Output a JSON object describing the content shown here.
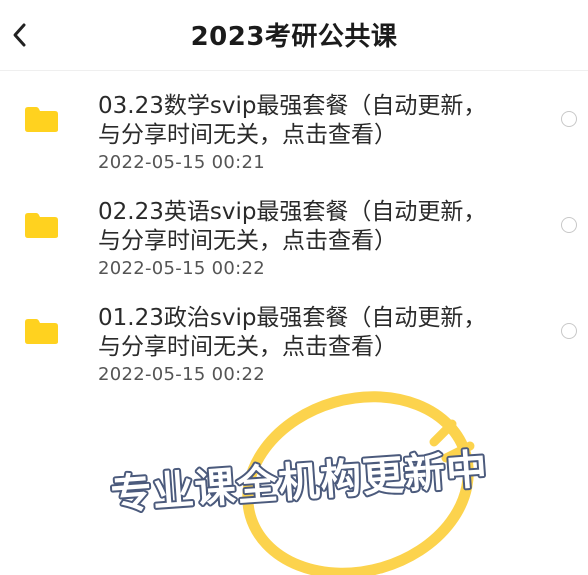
{
  "header": {
    "title": "2023考研公共课"
  },
  "files": [
    {
      "name": "03.23数学svip最强套餐（自动更新，与分享时间无关，点击查看）",
      "date": "2022-05-15 00:21"
    },
    {
      "name": "02.23英语svip最强套餐（自动更新，与分享时间无关，点击查看）",
      "date": "2022-05-15 00:22"
    },
    {
      "name": "01.23政治svip最强套餐（自动更新，与分享时间无关，点击查看）",
      "date": "2022-05-15 00:22"
    }
  ],
  "overlay": {
    "text": "专业课全机构更新中"
  },
  "colors": {
    "folder": "#FFD21F",
    "accent_yellow": "#FCD34D",
    "overlay_blue": "#4B5A7C"
  },
  "icons": {
    "back": "chevron-left-icon",
    "folder": "folder-icon",
    "select": "radio-circle-icon"
  }
}
